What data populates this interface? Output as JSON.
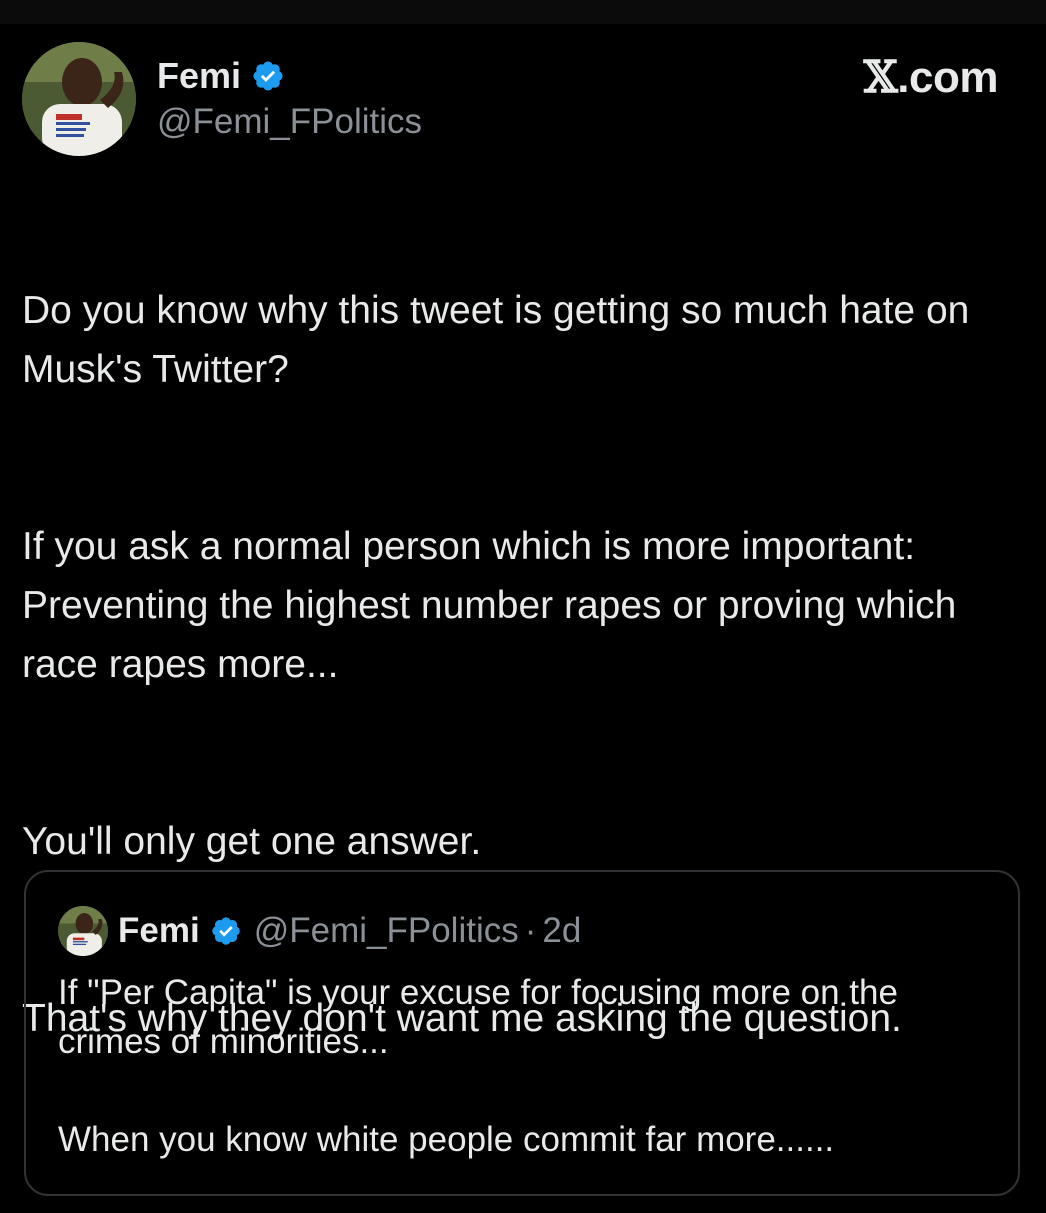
{
  "author": {
    "display_name": "Femi",
    "handle": "@Femi_FPolitics",
    "verified": true,
    "avatar_icon": "profile-photo-avatar"
  },
  "brand": {
    "prefix": "𝕏",
    "suffix": ".com"
  },
  "tweet": {
    "paragraphs": [
      "Do you know why this tweet is getting so much hate on Musk's Twitter?",
      "If you ask a normal person which is more important: Preventing the highest number rapes or proving which race rapes more...",
      "You'll only get one answer.",
      "That's why they don't want me asking the question."
    ]
  },
  "quoted_tweet": {
    "display_name": "Femi",
    "handle": "@Femi_FPolitics",
    "separator": "·",
    "time": "2d",
    "verified": true,
    "paragraphs": [
      "If \"Per Capita\" is your excuse for focusing more on the crimes of minorities...",
      "When you know white people commit far more......"
    ]
  },
  "colors": {
    "background": "#000000",
    "text": "#e7e9ea",
    "secondary_text": "#8b9097",
    "verified_badge": "#1d9bf0",
    "card_border": "#2f3336"
  }
}
